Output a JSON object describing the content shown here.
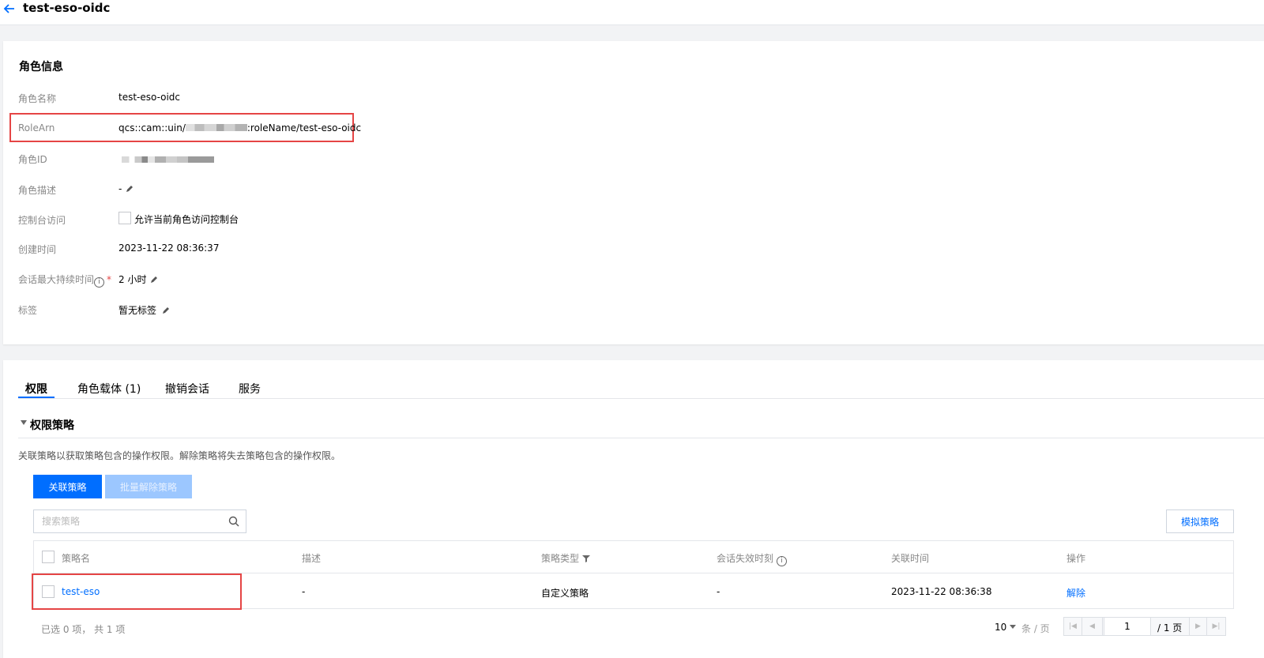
{
  "header": {
    "title": "test-eso-oidc"
  },
  "role_info": {
    "section_title": "角色信息",
    "fields": {
      "name": {
        "label": "角色名称",
        "value": "test-eso-oidc"
      },
      "arn": {
        "label": "RoleArn",
        "prefix": "qcs::cam::uin/",
        "suffix": ":roleName/test-eso-oidc"
      },
      "id": {
        "label": "角色ID"
      },
      "description": {
        "label": "角色描述",
        "value": "-"
      },
      "console_access": {
        "label": "控制台访问",
        "checkbox_label": "允许当前角色访问控制台",
        "checked": false
      },
      "created": {
        "label": "创建时间",
        "value": "2023-11-22 08:36:37"
      },
      "session_duration": {
        "label": "会话最大持续时间",
        "value": "2 小时"
      },
      "tags": {
        "label": "标签",
        "value": "暂无标签"
      }
    }
  },
  "tabs": [
    {
      "label": "权限",
      "active": true
    },
    {
      "label": "角色载体 (1)",
      "active": false
    },
    {
      "label": "撤销会话",
      "active": false
    },
    {
      "label": "服务",
      "active": false
    }
  ],
  "policy_section": {
    "title": "权限策略",
    "description": "关联策略以获取策略包含的操作权限。解除策略将失去策略包含的操作权限。",
    "associate_button": "关联策略",
    "batch_detach_button": "批量解除策略",
    "simulate_button": "模拟策略",
    "search_placeholder": "搜索策略"
  },
  "table": {
    "columns": [
      "策略名",
      "描述",
      "策略类型",
      "会话失效时刻",
      "关联时间",
      "操作"
    ],
    "rows": [
      {
        "name": "test-eso",
        "description": "-",
        "type": "自定义策略",
        "session_expiry": "-",
        "associated_time": "2023-11-22 08:36:38",
        "action": "解除"
      }
    ]
  },
  "footer": {
    "selection_summary": "已选 0 项， 共 1 项",
    "page_size": "10",
    "page_size_unit": "条 / 页",
    "current_page": "1",
    "total_pages": "/ 1 页"
  },
  "colors": {
    "accent": "#006eff",
    "highlight_box": "#e54545",
    "disabled_button": "#9cc7ff"
  }
}
